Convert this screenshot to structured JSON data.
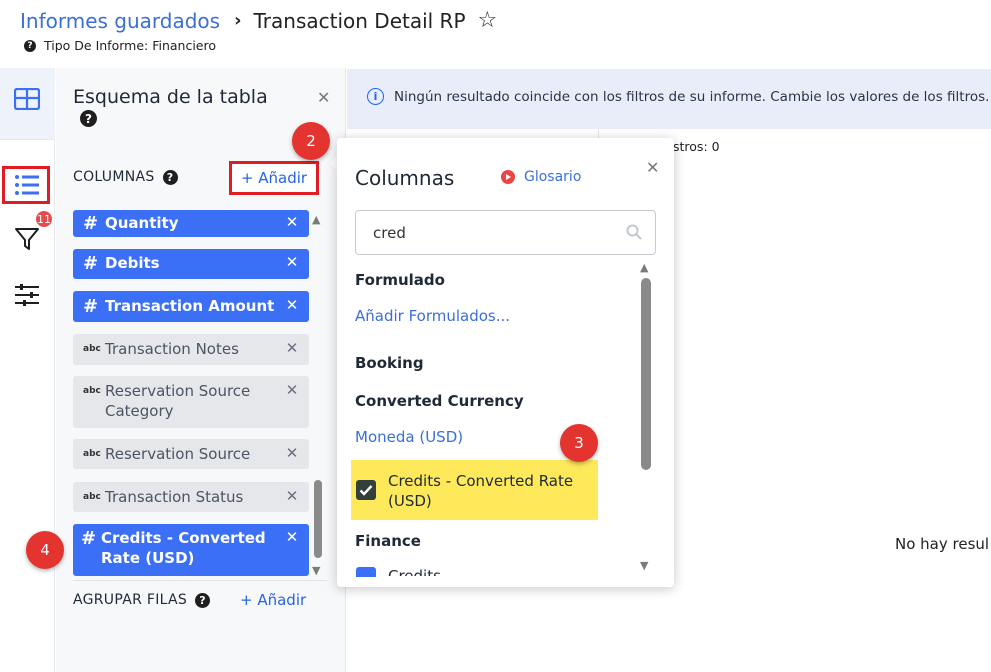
{
  "header": {
    "breadcrumb_link": "Informes guardados",
    "breadcrumb_current": "Transaction Detail RP",
    "subtitle": "Tipo De Informe: Financiero"
  },
  "rail": {
    "filter_badge": "11"
  },
  "schema": {
    "title": "Esquema de la tabla",
    "columns_label": "COLUMNAS",
    "add_columns": "+ Añadir",
    "columns": [
      {
        "type": "#",
        "label": "Quantity",
        "kind": "num"
      },
      {
        "type": "#",
        "label": "Debits",
        "kind": "num"
      },
      {
        "type": "#",
        "label": "Transaction Amount",
        "kind": "num"
      },
      {
        "type": "abc",
        "label": "Transaction Notes",
        "kind": "txt"
      },
      {
        "type": "abc",
        "label": "Reservation Source Category",
        "kind": "txt"
      },
      {
        "type": "abc",
        "label": "Reservation Source",
        "kind": "txt"
      },
      {
        "type": "abc",
        "label": "Transaction Status",
        "kind": "txt"
      },
      {
        "type": "#",
        "label": "Credits - Converted Rate (USD)",
        "kind": "num"
      }
    ],
    "group_label": "AGRUPAR FILAS",
    "add_group": "+ Añadir"
  },
  "main": {
    "info_message": "Ningún resultado coincide con los filtros de su informe. Cambie los valores de los filtros.",
    "records_text": "stros: 0",
    "no_results_text": "No hay resul"
  },
  "popover": {
    "title": "Columnas",
    "glossary": "Glosario",
    "search_value": "cred",
    "sections": {
      "formulado": "Formulado",
      "add_formulados": "Añadir Formulados...",
      "booking": "Booking",
      "converted_currency": "Converted Currency",
      "moneda": "Moneda (USD)",
      "finance": "Finance"
    },
    "checked_item": "Credits - Converted Rate (USD)",
    "cut_item": "Credits"
  },
  "steps": {
    "two": "2",
    "three": "3",
    "four": "4"
  },
  "colors": {
    "accent_blue": "#3b6ff5",
    "link_blue": "#3b6fd8",
    "highlight_red": "#e11d24",
    "step_red": "#e3342f",
    "highlight_yellow": "#fde95a"
  }
}
